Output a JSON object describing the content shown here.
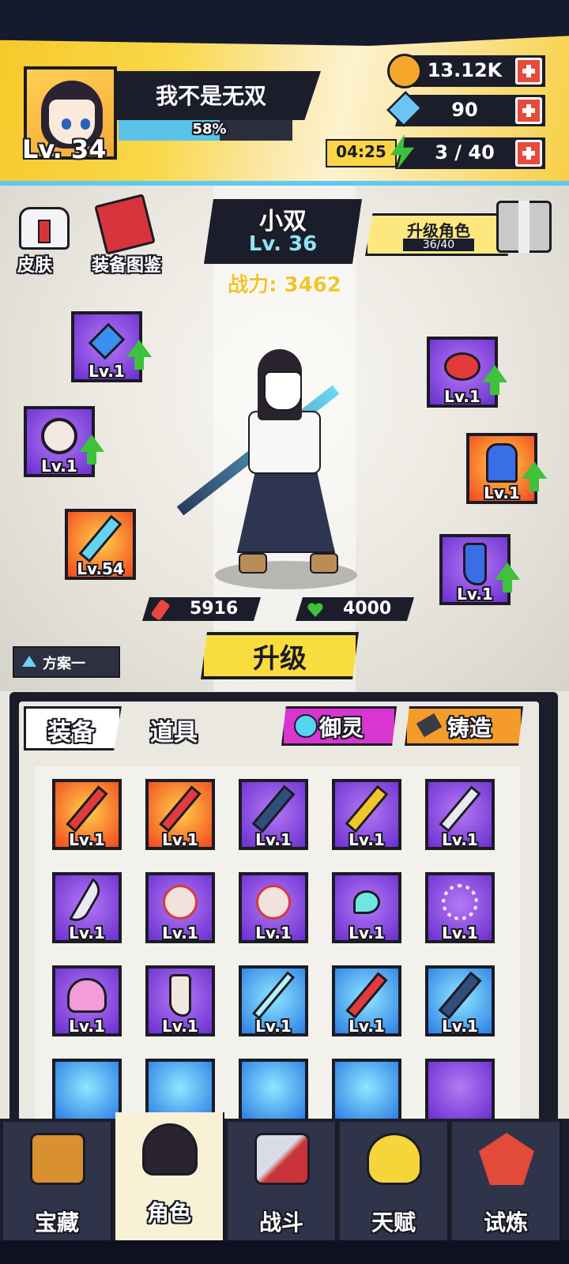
{
  "player": {
    "level": "Lv. 34",
    "name": "我不是无双",
    "exp_percent": "58%",
    "exp_fraction": 0.58
  },
  "resources": {
    "coins": "13.12K",
    "gems": "90",
    "stamina": "3 / 40",
    "stamina_timer": "04:25"
  },
  "shortcuts": {
    "skin_label": "皮肤",
    "codex_label": "装备图鉴"
  },
  "character": {
    "name": "小双",
    "level": "Lv. 36",
    "power": "战力: 3462",
    "attack": "5916",
    "hp": "4000"
  },
  "upgrade_character": {
    "label": "升级角色",
    "progress": "36/40"
  },
  "equipped": [
    {
      "slot": "necklace",
      "level": "Lv.1",
      "icon": "blue-gem-necklace-icon",
      "can_upgrade": true
    },
    {
      "slot": "ring",
      "level": "Lv.1",
      "icon": "charm-ring-icon",
      "can_upgrade": true
    },
    {
      "slot": "weapon",
      "level": "Lv.54",
      "icon": "blade-icon",
      "can_upgrade": false
    },
    {
      "slot": "helmet",
      "level": "Lv.1",
      "icon": "red-ribbon-icon",
      "can_upgrade": true
    },
    {
      "slot": "armor",
      "level": "Lv.1",
      "icon": "blue-gloves-icon",
      "can_upgrade": true
    },
    {
      "slot": "boots",
      "level": "Lv.1",
      "icon": "blue-boots-icon",
      "can_upgrade": true
    }
  ],
  "upgrade_button": "升级",
  "plan_label": "方案一",
  "bag": {
    "tab_equip": "装备",
    "tab_items": "道具",
    "yuling_label": "御灵",
    "forge_label": "铸造",
    "items": [
      {
        "level": "Lv.1",
        "icon": "red-sword-icon",
        "rarity": "orange"
      },
      {
        "level": "Lv.1",
        "icon": "red-sword-icon",
        "rarity": "orange"
      },
      {
        "level": "Lv.1",
        "icon": "jagged-blade-icon",
        "rarity": "purple"
      },
      {
        "level": "Lv.1",
        "icon": "golden-blade-icon",
        "rarity": "purple"
      },
      {
        "level": "Lv.1",
        "icon": "silver-blade-icon",
        "rarity": "purple"
      },
      {
        "level": "Lv.1",
        "icon": "curved-blade-icon",
        "rarity": "purple"
      },
      {
        "level": "Lv.1",
        "icon": "red-ring-icon",
        "rarity": "purple"
      },
      {
        "level": "Lv.1",
        "icon": "red-ring-icon",
        "rarity": "purple"
      },
      {
        "level": "Lv.1",
        "icon": "cyan-necklace-icon",
        "rarity": "purple"
      },
      {
        "level": "Lv.1",
        "icon": "bead-necklace-icon",
        "rarity": "purple"
      },
      {
        "level": "Lv.1",
        "icon": "pink-helmet-icon",
        "rarity": "purple"
      },
      {
        "level": "Lv.1",
        "icon": "brown-boots-icon",
        "rarity": "purple"
      },
      {
        "level": "Lv.1",
        "icon": "light-sword-icon",
        "rarity": "blue"
      },
      {
        "level": "Lv.1",
        "icon": "red-sword-icon",
        "rarity": "blue"
      },
      {
        "level": "Lv.1",
        "icon": "jagged-blade-icon",
        "rarity": "blue"
      }
    ]
  },
  "nav": [
    {
      "label": "宝藏",
      "icon": "treasure-chest-icon",
      "active": false
    },
    {
      "label": "角色",
      "icon": "character-portrait-icon",
      "active": true
    },
    {
      "label": "战斗",
      "icon": "crossed-swords-icon",
      "active": false
    },
    {
      "label": "天赋",
      "icon": "lightbulb-icon",
      "active": false
    },
    {
      "label": "试炼",
      "icon": "trial-emblem-icon",
      "active": false
    }
  ],
  "colors": {
    "accent_yellow": "#f9dd3f",
    "accent_blue": "#5bc3ea",
    "panel_dark": "#1b1d2b",
    "upgrade_green": "#3ec13b"
  }
}
